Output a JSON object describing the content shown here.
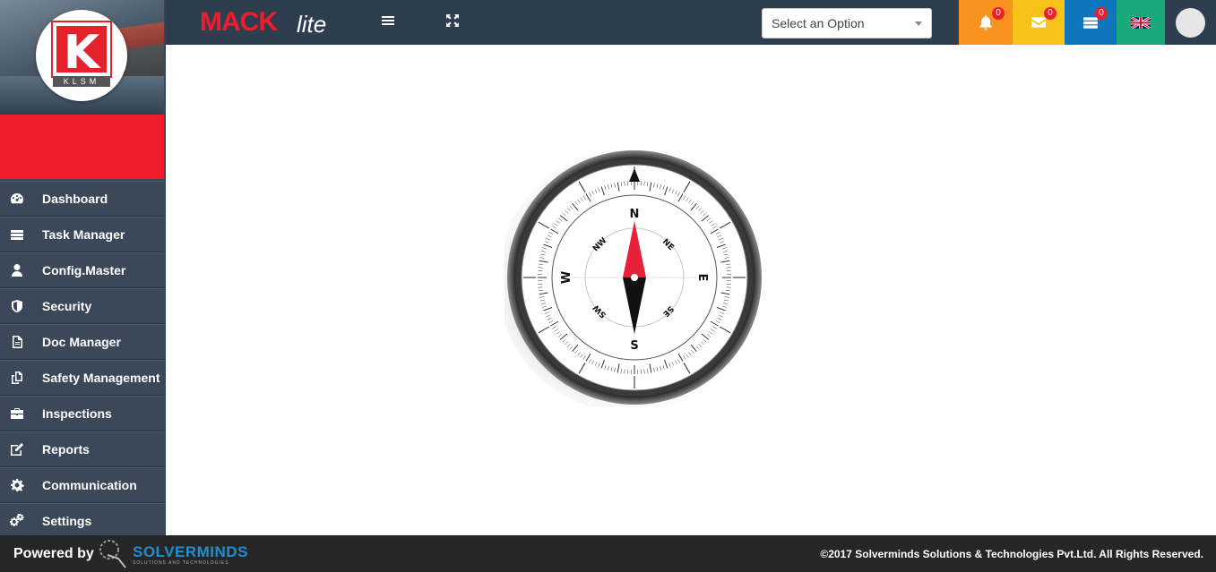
{
  "header": {
    "app_name": "MACK",
    "app_suffix": "lite",
    "select_placeholder": "Select an Option",
    "notifications": [
      {
        "icon": "bell-icon",
        "count": "0",
        "color": "#f7931e"
      },
      {
        "icon": "envelope-icon",
        "count": "0",
        "color": "#f9c21b"
      },
      {
        "icon": "server-icon",
        "count": "0",
        "color": "#0e76bc"
      },
      {
        "icon": "uk-flag-icon",
        "color": "#19a97a"
      }
    ]
  },
  "brand": {
    "logo_letter": "K",
    "logo_text": "KLSM"
  },
  "sidebar": {
    "items": [
      {
        "label": "Dashboard",
        "icon": "dashboard-icon"
      },
      {
        "label": "Task Manager",
        "icon": "tasks-icon"
      },
      {
        "label": "Config.Master",
        "icon": "user-icon"
      },
      {
        "label": "Security",
        "icon": "shield-icon"
      },
      {
        "label": "Doc Manager",
        "icon": "document-icon"
      },
      {
        "label": "Safety Management",
        "icon": "copy-icon"
      },
      {
        "label": "Inspections",
        "icon": "briefcase-icon"
      },
      {
        "label": "Reports",
        "icon": "edit-icon"
      },
      {
        "label": "Communication",
        "icon": "gear-icon"
      },
      {
        "label": "Settings",
        "icon": "gears-icon"
      }
    ]
  },
  "compass": {
    "cardinals": {
      "n": "N",
      "e": "E",
      "s": "S",
      "w": "W"
    },
    "intercardinals": {
      "ne": "NE",
      "se": "SE",
      "sw": "SW",
      "nw": "NW"
    }
  },
  "footer": {
    "powered_by": "Powered by",
    "company": "SOLVERMINDS",
    "tagline": "SOLUTIONS AND TECHNOLOGIES",
    "copyright": "©2017 Solverminds Solutions & Technologies Pvt.Ltd. All Rights Reserved."
  },
  "colors": {
    "brand_red": "#ef1c2b",
    "sidebar": "#3a4859",
    "header": "#2f3e4f"
  }
}
